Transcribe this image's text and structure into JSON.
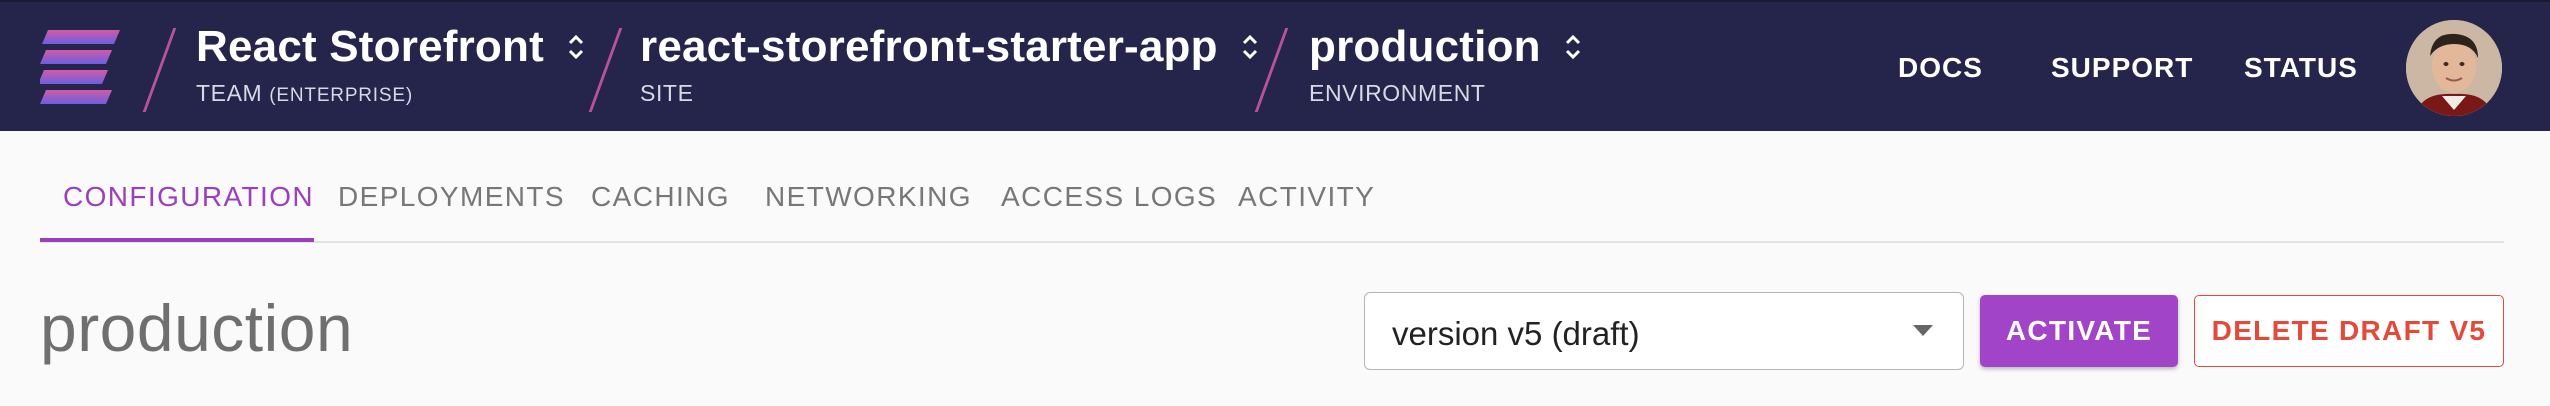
{
  "header": {
    "team": {
      "name": "React Storefront",
      "type_label": "TEAM",
      "plan": "(ENTERPRISE)"
    },
    "site": {
      "name": "react-storefront-starter-app",
      "type_label": "SITE"
    },
    "environment": {
      "name": "production",
      "type_label": "ENVIRONMENT"
    },
    "nav": [
      "DOCS",
      "SUPPORT",
      "STATUS"
    ]
  },
  "tabs": [
    {
      "label": "CONFIGURATION",
      "active": true
    },
    {
      "label": "DEPLOYMENTS",
      "active": false
    },
    {
      "label": "CACHING",
      "active": false
    },
    {
      "label": "NETWORKING",
      "active": false
    },
    {
      "label": "ACCESS LOGS",
      "active": false
    },
    {
      "label": "ACTIVITY",
      "active": false
    }
  ],
  "main": {
    "title": "production",
    "version_select": {
      "value": "version v5 (draft)"
    },
    "activate_label": "ACTIVATE",
    "delete_label": "DELETE DRAFT V5"
  },
  "colors": {
    "topbar": "#25244a",
    "accent": "#9c3fbd",
    "danger": "#e34a3a"
  }
}
